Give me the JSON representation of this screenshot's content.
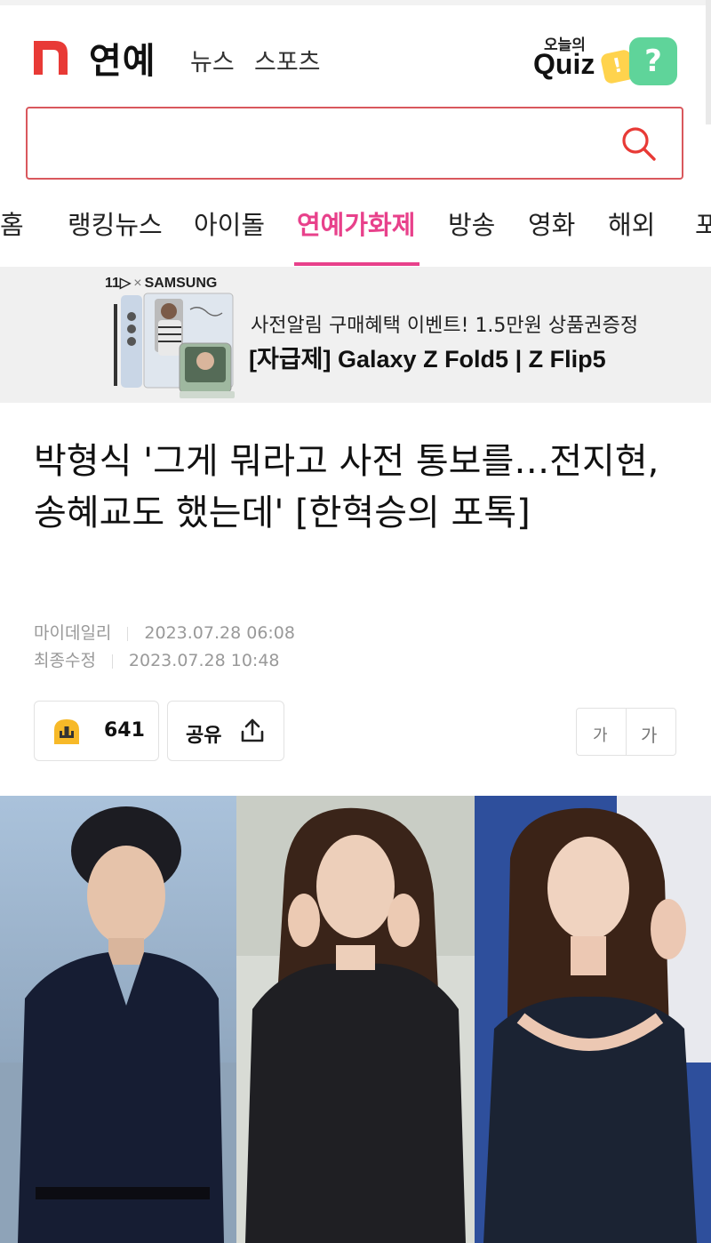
{
  "header": {
    "logo_letter": "n",
    "brand": "연예",
    "nav": [
      "뉴스",
      "스포츠"
    ],
    "quiz_top": "오늘의",
    "quiz_main": "Quiz",
    "quiz_badge": "!",
    "quiz_question": "?"
  },
  "search": {
    "value": "",
    "placeholder": ""
  },
  "tabs": [
    "홈",
    "랭킹뉴스",
    "아이돌",
    "연예가화제",
    "방송",
    "영화",
    "해외",
    "포"
  ],
  "active_tab": "연예가화제",
  "ad": {
    "brand_left": "11",
    "brand_x": "×",
    "brand_right": "SAMSUNG",
    "line1": "사전알림 구매혜택 이벤트! 1.5만원 상품권증정",
    "line2": "[자급제] Galaxy Z Fold5 | Z Flip5"
  },
  "article": {
    "headline": "박형식 '그게 뭐라고 사전 통보를…전지현,송혜교도 했는데' [한혁승의 포톡]",
    "source": "마이데일리",
    "published": "2023.07.28 06:08",
    "modified_label": "최종수정",
    "modified": "2023.07.28 10:48",
    "reactions": "641",
    "share_label": "공유",
    "font_small": "가",
    "font_large": "가"
  },
  "colors": {
    "accent_pink": "#e8418b",
    "search_border": "#d9585d",
    "logo_red": "#e83a36"
  }
}
